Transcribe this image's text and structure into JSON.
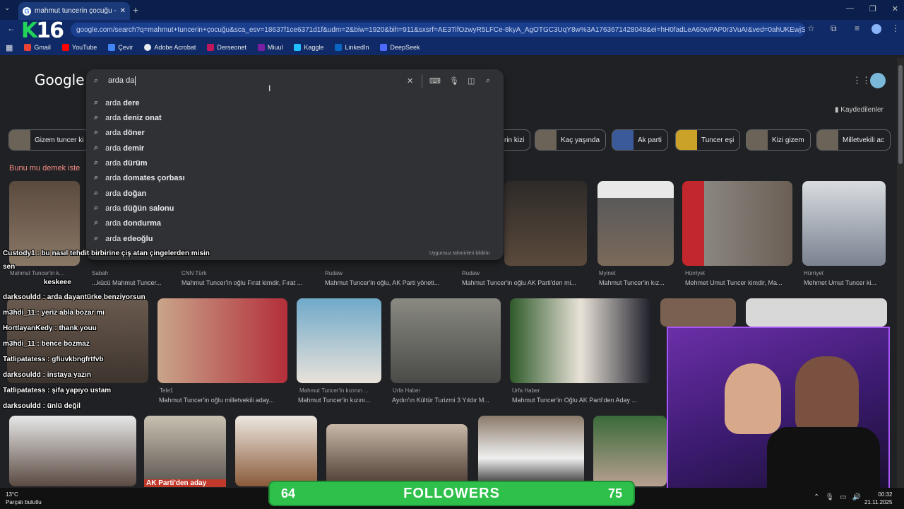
{
  "browser": {
    "tab_title": "mahmut tuncerin çocuğu - Go",
    "address": "google.com/search?q=mahmut+tuncerin+çocuğu&sca_esv=18637f1ce6371d1f&udm=2&biw=1920&bih=911&sxsrf=AE3TifOzwyR5LFCe-8kyA_AgOTGC3UqY8w%3A1763671428048&ei=hH0fadLeA60wPAP0r3VuAI&ved=0ahUKEwjSsOCHzIGRAxU-",
    "bookmarks": [
      "Gmail",
      "YouTube",
      "Çevir",
      "Adobe Acrobat",
      "Derseonet",
      "Miuul",
      "Kaggle",
      "LinkedIn",
      "DeepSeek"
    ]
  },
  "overlay": {
    "logo_k": "K",
    "logo_num": "16"
  },
  "google": {
    "logo": "Google",
    "query": "arda da",
    "saved": "Kaydedilenler",
    "report": "Uygunsuz tahminleri bildirin",
    "suggestions": [
      {
        "pre": "arda ",
        "bold": "dere"
      },
      {
        "pre": "arda ",
        "bold": "deniz onat"
      },
      {
        "pre": "arda ",
        "bold": "döner"
      },
      {
        "pre": "arda ",
        "bold": "demir"
      },
      {
        "pre": "arda ",
        "bold": "dürüm"
      },
      {
        "pre": "arda ",
        "bold": "domates çorbası"
      },
      {
        "pre": "arda ",
        "bold": "doğan"
      },
      {
        "pre": "arda ",
        "bold": "düğün salonu"
      },
      {
        "pre": "arda ",
        "bold": "dondurma"
      },
      {
        "pre": "arda ",
        "bold": "edeoğlu"
      }
    ],
    "chips": [
      "Gizem tuncer ki",
      "rin kizi",
      "Kaç yaşında",
      "Ak parti",
      "Tuncer eşi",
      "Kizi gizem",
      "Milletvekili ac"
    ],
    "row1_heading": "Bunu mu demek iste",
    "row1": [
      {
        "src": "Mahmut Tuncer'in k...",
        "cap": ""
      },
      {
        "src": "Sabah",
        "cap": "...kücü Mahmut Tuncer..."
      },
      {
        "src": "CNN Türk",
        "cap": "Mahmut Tuncer'in oğlu Fırat kimdir, Fırat ..."
      },
      {
        "src": "Rudaw",
        "cap": "Mahmut Tuncer'in oğlu, AK Parti yöneti..."
      },
      {
        "src": "Rudaw",
        "cap": "Mahmut Tuncer'in oğlu AK Parti'den mi..."
      },
      {
        "src": "Myinet",
        "cap": "Mahmut Tuncer'in kız..."
      },
      {
        "src": "Hürriyet",
        "cap": "Mehmet Umut Tuncer kimdir, Ma..."
      },
      {
        "src": "Hürriyet",
        "cap": "Mehmet Umut Tuncer ki..."
      }
    ],
    "row2": [
      {
        "src": "Tele1",
        "cap": "Mahmut Tuncer'in oğlu milletvekili aday..."
      },
      {
        "src": "Mahmut Tuncer'in kızının ...",
        "cap": "Mahmut Tuncer'in kızını..."
      },
      {
        "src": "Urfa Haber",
        "cap": "Aydın'ın Kültür Turizmi 3 Yıldır M..."
      },
      {
        "src": "Urfa Haber",
        "cap": "Mahmut Tuncer'in Oğlu AK Parti'den Aday ..."
      }
    ],
    "row3_badge": "AK Parti'den aday"
  },
  "chat": [
    {
      "text": "Custody1 : bu nasıl tehdit birbirine çiş atan çingelerden misin",
      "color": "#ffffff"
    },
    {
      "text": "sen",
      "color": "#ffffff"
    },
    {
      "text": "keskeee",
      "color": "#ffffff"
    },
    {
      "text": "darksouldd : arda dayantürke benziyorsun",
      "color": "#ffffff"
    },
    {
      "text": "m3hdi_11 : yeriz abla bozar mı",
      "color": "#ffffff"
    },
    {
      "text": "HortlayanKedy : thank youu",
      "color": "#ffffff"
    },
    {
      "text": "m3hdi_11 : bence bozmaz",
      "color": "#ffffff"
    },
    {
      "text": "Tatlipatatess : gfiuvkbngfrtfvb",
      "color": "#ffffff"
    },
    {
      "text": "darksouldd : instaya yazın",
      "color": "#ffffff"
    },
    {
      "text": "Tatlipatatess : şifa yapıyo ustam",
      "color": "#ffffff"
    },
    {
      "text": "darksouldd : ünlü değil",
      "color": "#ffffff"
    }
  ],
  "followers": {
    "left": "64",
    "label": "FOLLOWERS",
    "right": "75"
  },
  "taskbar": {
    "temp": "13°C",
    "weather": "Parçalı bulutlu",
    "time": "00:32",
    "date": "21.11.2025"
  }
}
